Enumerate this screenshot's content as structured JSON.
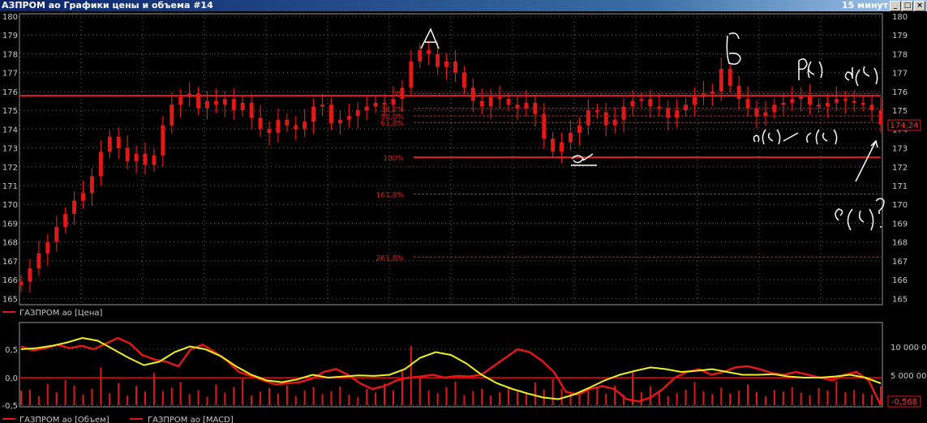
{
  "window": {
    "title": "АЗПРОМ ао Графики цены и объема #14",
    "timeframe": "15 минут"
  },
  "price_panel": {
    "legend": "ГАЗПРОМ ао [Цена]",
    "last_price_label": "174,24",
    "colors": {
      "background": "#000000",
      "candles": "#e01818",
      "grid": "#7a7a7a",
      "fib": "#e02020",
      "axis_text": "#c8c8c8"
    }
  },
  "indicator_panel": {
    "legend_volume": "ГАЗПРОМ ао [Объем]",
    "legend_macd": "ГАЗПРОМ ао [MACD]",
    "last_value_label": "-0,568",
    "colors": {
      "macd": "#e01818",
      "signal": "#f0f020",
      "volume": "#e01818",
      "zero": "#ff0000"
    }
  },
  "annotations": {
    "handwritten": [
      "A",
      "a",
      "b",
      "b(c)",
      "d(c)",
      "a(c)",
      "c(c)",
      "e(c)?"
    ]
  },
  "chart_data": [
    {
      "type": "candlestick",
      "title": "",
      "y_ticks": [
        "180",
        "179",
        "178",
        "177",
        "176",
        "175",
        "174",
        "173",
        "172",
        "171",
        "170",
        "169",
        "168",
        "167",
        "166",
        "165"
      ],
      "ylim": [
        164.8,
        180
      ],
      "grid": true,
      "fib_levels": [
        {
          "label": "0%",
          "value": 175.9
        },
        {
          "label": "38,2%",
          "value": 175.1
        },
        {
          "label": "50,0%",
          "value": 174.7
        },
        {
          "label": "61,8%",
          "value": 174.35
        },
        {
          "label": "100%",
          "value": 172.5
        },
        {
          "label": "161,8%",
          "value": 170.55
        },
        {
          "label": "261,8%",
          "value": 167.2
        }
      ],
      "series": [
        {
          "close": [
            165.9,
            166.6,
            167.4,
            168.0,
            168.8,
            169.5,
            170.2,
            170.6,
            171.5,
            172.8,
            173.6,
            173.0,
            172.3,
            172.7,
            172.1,
            172.6,
            174.2,
            175.3,
            175.7,
            175.9,
            175.1,
            175.5,
            175.3,
            175.6,
            175.0,
            175.4,
            174.6,
            174.0,
            173.8,
            174.5,
            174.2,
            174.0,
            174.4,
            175.2,
            175.3,
            174.3,
            174.5,
            174.7,
            175.0,
            175.2,
            175.4,
            175.3,
            175.6,
            176.2,
            177.6,
            178.2,
            178.0,
            177.3,
            177.6,
            177.0,
            176.2,
            175.5,
            175.2,
            175.7,
            175.6,
            175.3,
            175.1,
            175.4,
            174.8,
            173.5,
            172.8,
            173.3,
            173.8,
            174.2,
            175.0,
            174.9,
            174.2,
            174.5,
            175.2,
            175.5,
            175.6,
            175.2,
            175.1,
            174.6,
            175.0,
            175.3,
            175.7,
            175.9,
            176.0,
            177.2,
            176.3,
            175.6,
            175.1,
            174.7,
            174.9,
            175.3,
            175.4,
            175.6,
            175.8,
            175.3,
            175.2,
            175.4,
            175.6,
            175.5,
            175.4,
            175.3,
            175.0,
            174.24
          ]
        }
      ]
    },
    {
      "type": "bar+line",
      "title": "",
      "y_ticks_left": [
        "0,5",
        "0,0",
        "-0,5"
      ],
      "y_ticks_right": [
        "10 000 00",
        "5 000 00"
      ],
      "series": [
        {
          "name": "ГАЗПРОМ ао [Объем]",
          "values": [
            2.9,
            3.1,
            1.8,
            4.2,
            2.6,
            5.0,
            3.9,
            2.1,
            3.3,
            7.5,
            2.4,
            4.4,
            1.9,
            3.8,
            2.7,
            6.4,
            2.8,
            3.5,
            4.6,
            2.2,
            3.0,
            1.7,
            4.1,
            2.5,
            3.6,
            5.2,
            1.9,
            2.7,
            3.4,
            2.3,
            4.0,
            1.8,
            2.9,
            3.6,
            2.2,
            2.8,
            3.7,
            2.1,
            1.6,
            3.2,
            2.5,
            4.3,
            2.9,
            6.9,
            11.8,
            5.6,
            3.0,
            2.4,
            3.6,
            4.7,
            2.0,
            2.8,
            3.3,
            1.9,
            2.6,
            3.4,
            2.7,
            2.2,
            4.5,
            3.1,
            5.2,
            3.3,
            2.4,
            1.9,
            2.8,
            3.6,
            2.3,
            3.9,
            2.1,
            6.5,
            2.6,
            3.8,
            2.9,
            1.8,
            2.4,
            3.1,
            4.6,
            2.8,
            2.2,
            3.5,
            2.3,
            2.9,
            4.1,
            2.6,
            1.8,
            3.0,
            2.7,
            3.6,
            2.5,
            2.0,
            3.4,
            2.9,
            4.8,
            2.6,
            3.0,
            2.3,
            2.1,
            3.8
          ]
        },
        {
          "name": "ГАЗПРОМ ао [MACD]",
          "values": [
            0.55,
            0.48,
            0.52,
            0.58,
            0.52,
            0.56,
            0.5,
            0.6,
            0.7,
            0.6,
            0.4,
            0.32,
            0.28,
            0.2,
            0.5,
            0.58,
            0.45,
            0.3,
            0.1,
            0.03,
            -0.05,
            -0.12,
            -0.1,
            -0.08,
            -0.02,
            0.1,
            0.15,
            0.05,
            -0.1,
            -0.2,
            -0.15,
            -0.05,
            0.0,
            0.02,
            0.05,
            0.0,
            0.03,
            0.02,
            0.05,
            0.2,
            0.35,
            0.5,
            0.45,
            0.3,
            0.1,
            -0.25,
            -0.3,
            -0.2,
            -0.15,
            -0.2,
            -0.38,
            -0.42,
            -0.35,
            -0.2,
            0.0,
            0.1,
            0.15,
            0.05,
            0.1,
            0.18,
            0.2,
            0.15,
            0.08,
            0.05,
            0.1,
            0.05,
            0.0,
            -0.05,
            0.05,
            0.1,
            -0.05,
            -0.568
          ]
        },
        {
          "name": "signal",
          "values": [
            0.5,
            0.52,
            0.56,
            0.62,
            0.7,
            0.65,
            0.5,
            0.35,
            0.22,
            0.28,
            0.45,
            0.55,
            0.5,
            0.38,
            0.2,
            0.05,
            -0.05,
            -0.08,
            -0.03,
            0.05,
            0.0,
            0.02,
            0.04,
            0.03,
            0.05,
            0.15,
            0.35,
            0.45,
            0.4,
            0.25,
            0.05,
            -0.1,
            -0.2,
            -0.28,
            -0.35,
            -0.38,
            -0.3,
            -0.18,
            -0.05,
            0.05,
            0.12,
            0.18,
            0.15,
            0.1,
            0.12,
            0.15,
            0.1,
            0.05,
            0.05,
            0.06,
            0.02,
            0.0,
            0.0,
            0.02,
            0.05,
            0.0,
            -0.1
          ]
        }
      ]
    }
  ]
}
